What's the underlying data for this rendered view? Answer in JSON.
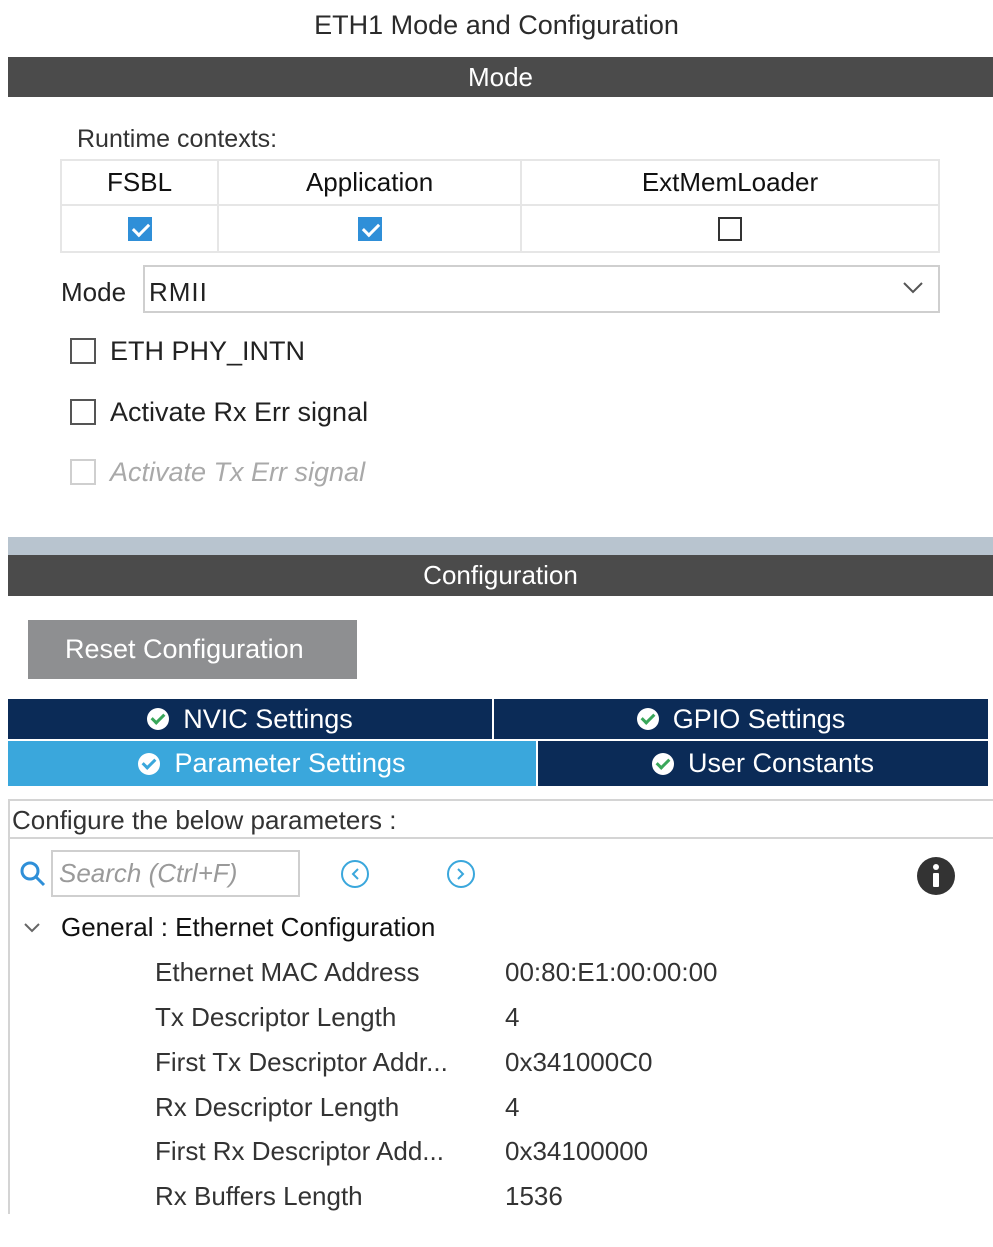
{
  "title": "ETH1 Mode and Configuration",
  "mode_section": {
    "header": "Mode",
    "runtime_label": "Runtime contexts:",
    "contexts": [
      {
        "name": "FSBL",
        "checked": true
      },
      {
        "name": "Application",
        "checked": true
      },
      {
        "name": "ExtMemLoader",
        "checked": false
      }
    ],
    "mode_label": "Mode",
    "mode_value": "RMII",
    "options": [
      {
        "label": "ETH PHY_INTN",
        "checked": false,
        "enabled": true
      },
      {
        "label": "Activate Rx Err signal",
        "checked": false,
        "enabled": true
      },
      {
        "label": "Activate Tx Err signal",
        "checked": false,
        "enabled": false
      }
    ]
  },
  "config_section": {
    "header": "Configuration",
    "reset_label": "Reset Configuration",
    "tabs": [
      {
        "label": "NVIC Settings",
        "active": false
      },
      {
        "label": "GPIO Settings",
        "active": false
      },
      {
        "label": "Parameter Settings",
        "active": true
      },
      {
        "label": "User Constants",
        "active": false
      }
    ],
    "description": "Configure the below parameters :",
    "search_placeholder": "Search (Ctrl+F)",
    "group_label": "General : Ethernet Configuration",
    "params": [
      {
        "name": "Ethernet MAC Address",
        "value": "00:80:E1:00:00:00"
      },
      {
        "name": "Tx Descriptor Length",
        "value": "4"
      },
      {
        "name": "First Tx Descriptor Addr...",
        "value": "0x341000C0"
      },
      {
        "name": "Rx Descriptor Length",
        "value": "4"
      },
      {
        "name": "First Rx Descriptor Add...",
        "value": "0x34100000"
      },
      {
        "name": "Rx Buffers Length",
        "value": "1536"
      }
    ]
  },
  "colors": {
    "section_bar": "#4b4b4b",
    "tab_dark": "#0b2b57",
    "tab_active": "#3aa7dc",
    "checkbox_on": "#2f8fd8",
    "reset_button": "#8e8f91"
  }
}
